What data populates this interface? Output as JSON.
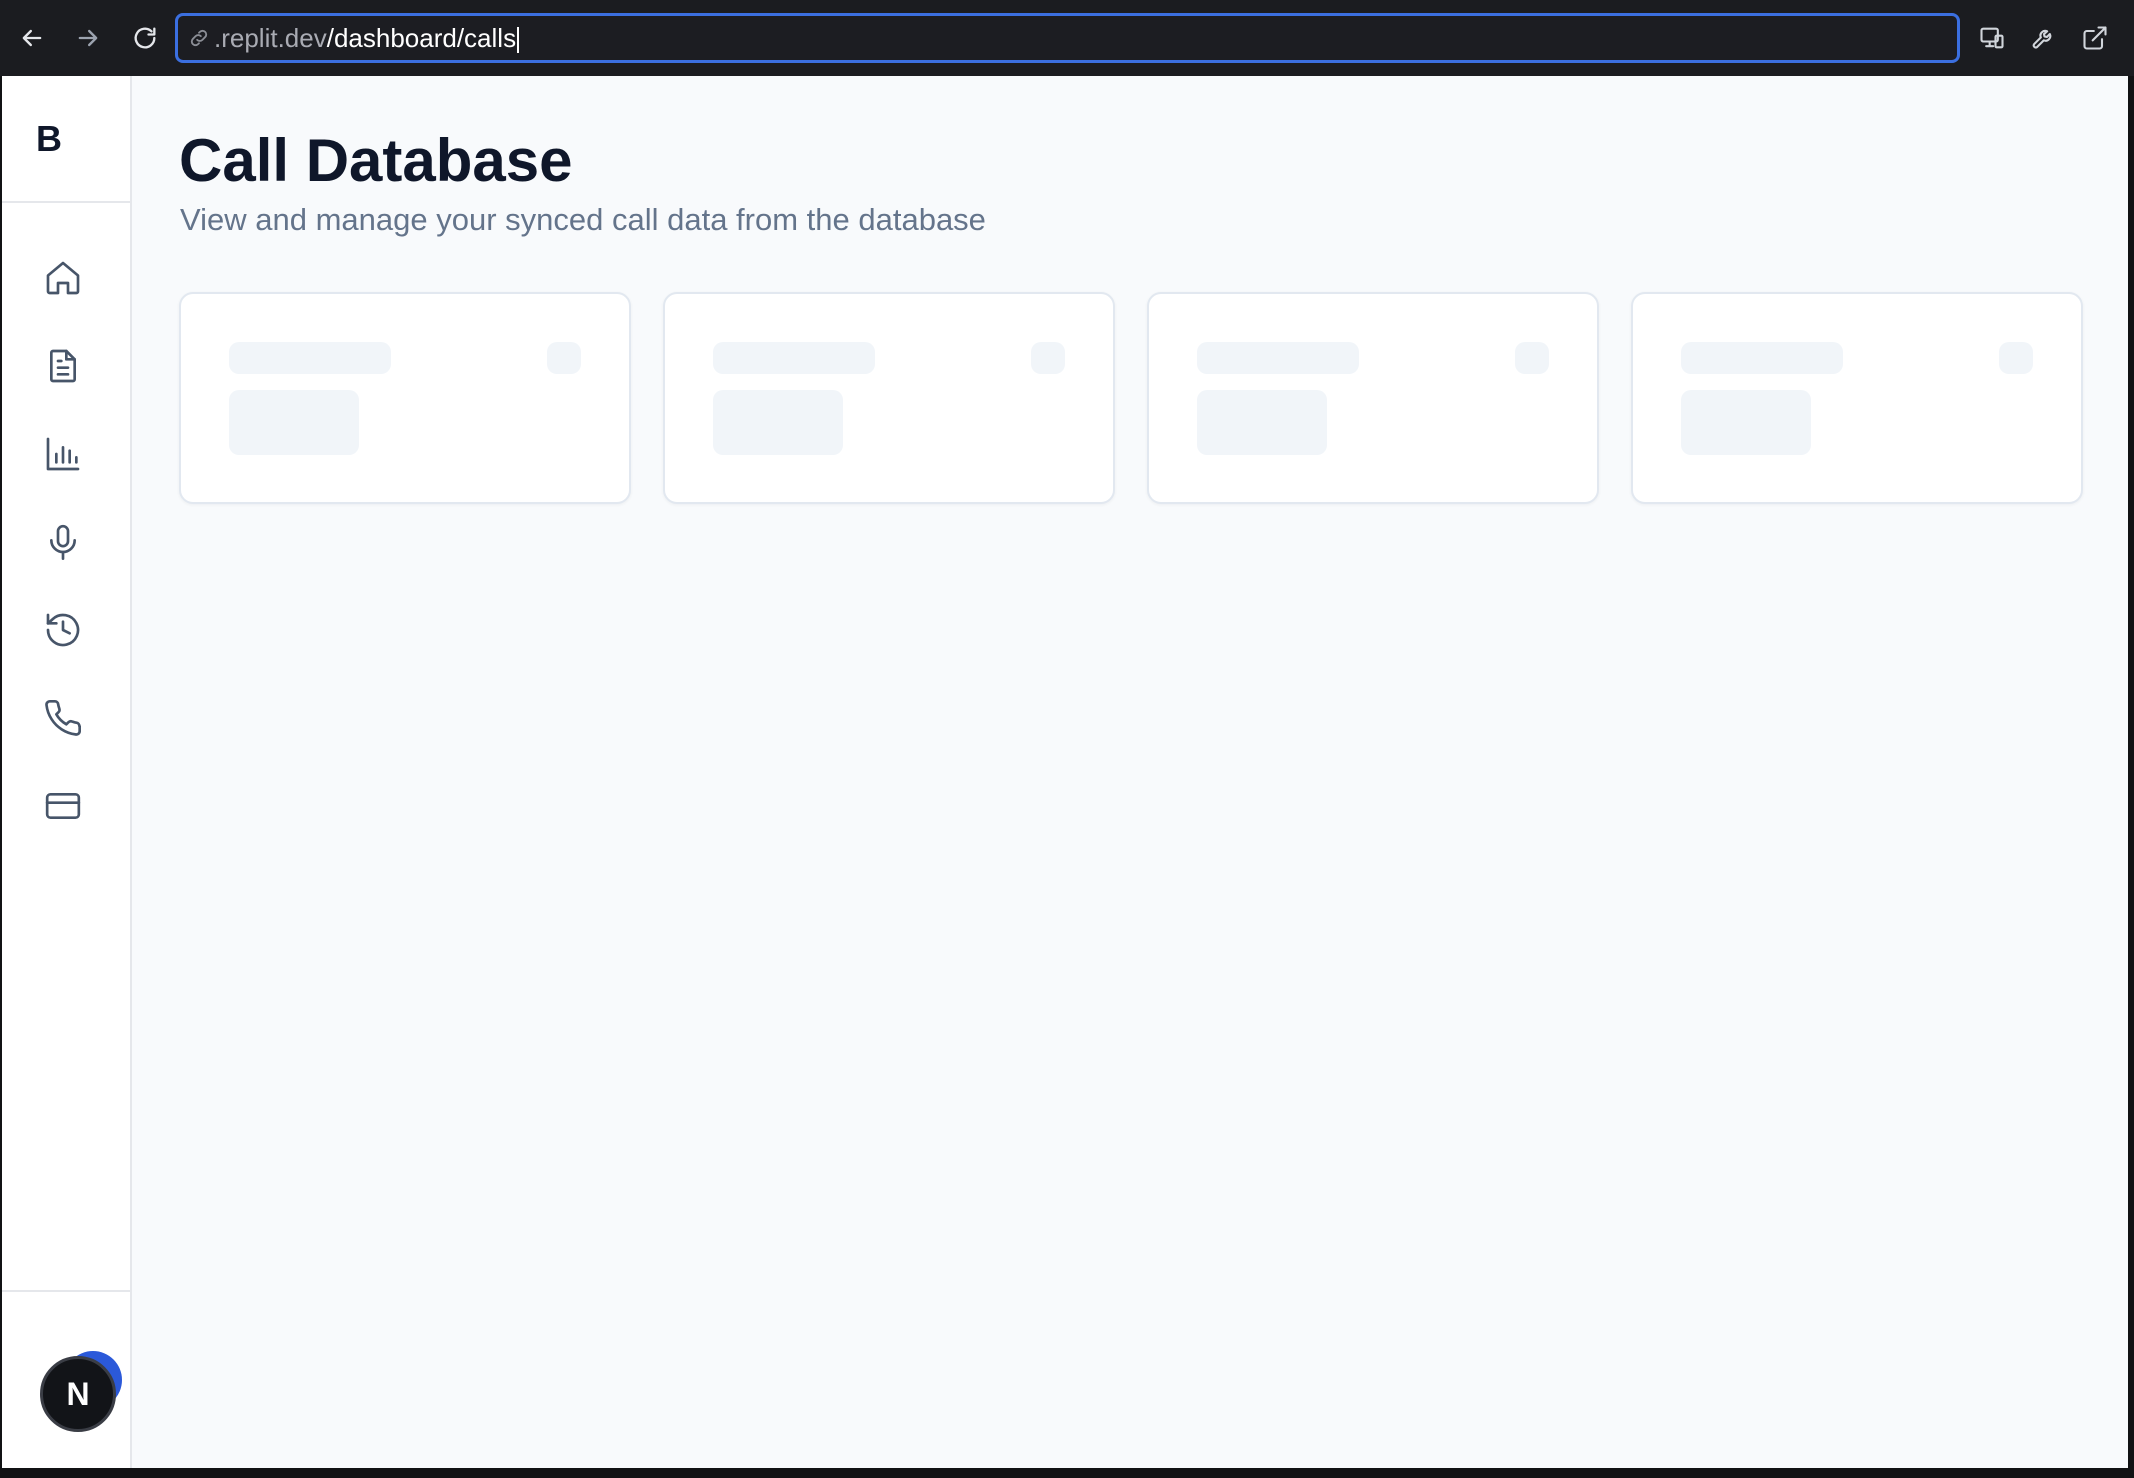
{
  "browser": {
    "url_host": ".replit.dev",
    "url_path": "/dashboard/calls",
    "icons": [
      "back-arrow-icon",
      "forward-arrow-icon",
      "reload-icon",
      "link-icon",
      "devices-icon",
      "wrench-icon",
      "external-link-icon"
    ]
  },
  "sidebar": {
    "brand": "B",
    "items": [
      {
        "icon": "home-icon"
      },
      {
        "icon": "document-icon"
      },
      {
        "icon": "bar-chart-icon"
      },
      {
        "icon": "microphone-icon"
      },
      {
        "icon": "history-icon"
      },
      {
        "icon": "phone-icon"
      },
      {
        "icon": "credit-card-icon"
      }
    ],
    "avatar_initial": "N",
    "notification_color": "#2b59d9"
  },
  "main": {
    "title": "Call Database",
    "subtitle": "View and manage your synced call data from the database",
    "stat_cards": [
      {
        "state": "loading"
      },
      {
        "state": "loading"
      },
      {
        "state": "loading"
      },
      {
        "state": "loading"
      }
    ]
  },
  "colors": {
    "url_focus_border": "#3b6fe0",
    "page_background": "#f8fafc",
    "title": "#0f172a",
    "subtitle": "#64748b",
    "skeleton": "#f1f5f9"
  }
}
